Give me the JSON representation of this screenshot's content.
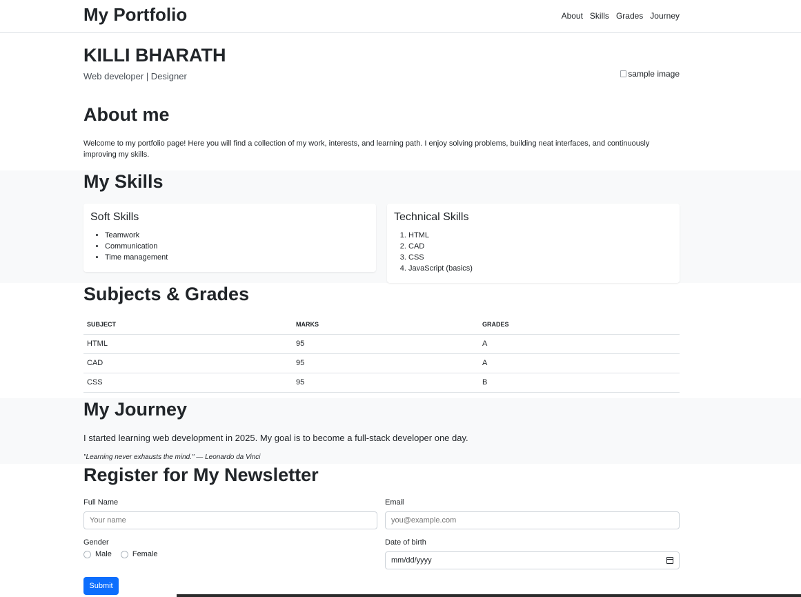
{
  "nav": {
    "brand": "My Portfolio",
    "links": [
      "About",
      "Skills",
      "Grades",
      "Journey"
    ]
  },
  "hero": {
    "name": "KILLI BHARATH",
    "role": "Web developer | Designer",
    "image_alt": "sample image"
  },
  "about": {
    "title": "About me",
    "text": "Welcome to my portfolio page! Here you will find a collection of my work, interests, and learning path. I enjoy solving problems, building neat interfaces, and continuously improving my skills."
  },
  "skills": {
    "title": "My Skills",
    "soft": {
      "title": "Soft Skills",
      "items": [
        "Teamwork",
        "Communication",
        "Time management"
      ]
    },
    "technical": {
      "title": "Technical Skills",
      "items": [
        "HTML",
        "CAD",
        "CSS",
        "JavaScript (basics)"
      ]
    }
  },
  "grades": {
    "title": "Subjects & Grades",
    "headers": [
      "SUBJECT",
      "MARKS",
      "GRADES"
    ],
    "rows": [
      [
        "HTML",
        "95",
        "A"
      ],
      [
        "CAD",
        "95",
        "A"
      ],
      [
        "CSS",
        "95",
        "B"
      ]
    ]
  },
  "journey": {
    "title": "My Journey",
    "text": "I started learning web development in 2025. My goal is to become a full-stack developer one day.",
    "quote": "\"Learning never exhausts the mind.\" — Leonardo da Vinci"
  },
  "newsletter": {
    "title": "Register for My Newsletter",
    "full_name_label": "Full Name",
    "full_name_placeholder": "Your name",
    "email_label": "Email",
    "email_placeholder": "you@example.com",
    "gender_label": "Gender",
    "gender_options": [
      "Male",
      "Female"
    ],
    "dob_label": "Date of birth",
    "dob_placeholder": "mm/dd/yyyy",
    "submit_label": "Submit"
  },
  "colors": {
    "primary": "#0d6efd",
    "light_bg": "#f8f9fa",
    "text": "#212529"
  }
}
